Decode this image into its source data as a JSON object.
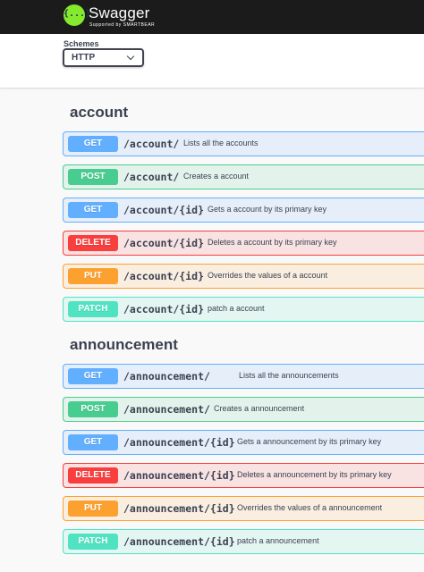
{
  "header": {
    "logo_icon": "{...}",
    "logo_text": "Swagger",
    "logo_sub": "Supported by SMARTBEAR"
  },
  "schemes": {
    "label": "Schemes",
    "selected": "HTTP"
  },
  "colors": {
    "get": "#61affe",
    "post": "#49cc90",
    "delete": "#f93e3e",
    "put": "#fca130",
    "patch": "#50e3c2"
  },
  "sections": [
    {
      "title": "account",
      "operations": [
        {
          "method": "GET",
          "path": "/account/",
          "desc": "Lists all the accounts"
        },
        {
          "method": "POST",
          "path": "/account/",
          "desc": "Creates a account"
        },
        {
          "method": "GET",
          "path": "/account/{id}",
          "desc": "Gets a account by its primary key"
        },
        {
          "method": "DELETE",
          "path": "/account/{id}",
          "desc": "Deletes a account by its primary key"
        },
        {
          "method": "PUT",
          "path": "/account/{id}",
          "desc": "Overrides the values of a account"
        },
        {
          "method": "PATCH",
          "path": "/account/{id}",
          "desc": "patch a account"
        }
      ]
    },
    {
      "title": "announcement",
      "operations": [
        {
          "method": "GET",
          "path": "/announcement/",
          "desc": "Lists all the announcements"
        },
        {
          "method": "POST",
          "path": "/announcement/",
          "desc": "Creates a announcement"
        },
        {
          "method": "GET",
          "path": "/announcement/{id}",
          "desc": "Gets a announcement by its primary key"
        },
        {
          "method": "DELETE",
          "path": "/announcement/{id}",
          "desc": "Deletes a announcement by its primary key"
        },
        {
          "method": "PUT",
          "path": "/announcement/{id}",
          "desc": "Overrides the values of a announcement"
        },
        {
          "method": "PATCH",
          "path": "/announcement/{id}",
          "desc": "patch a announcement"
        }
      ]
    }
  ]
}
